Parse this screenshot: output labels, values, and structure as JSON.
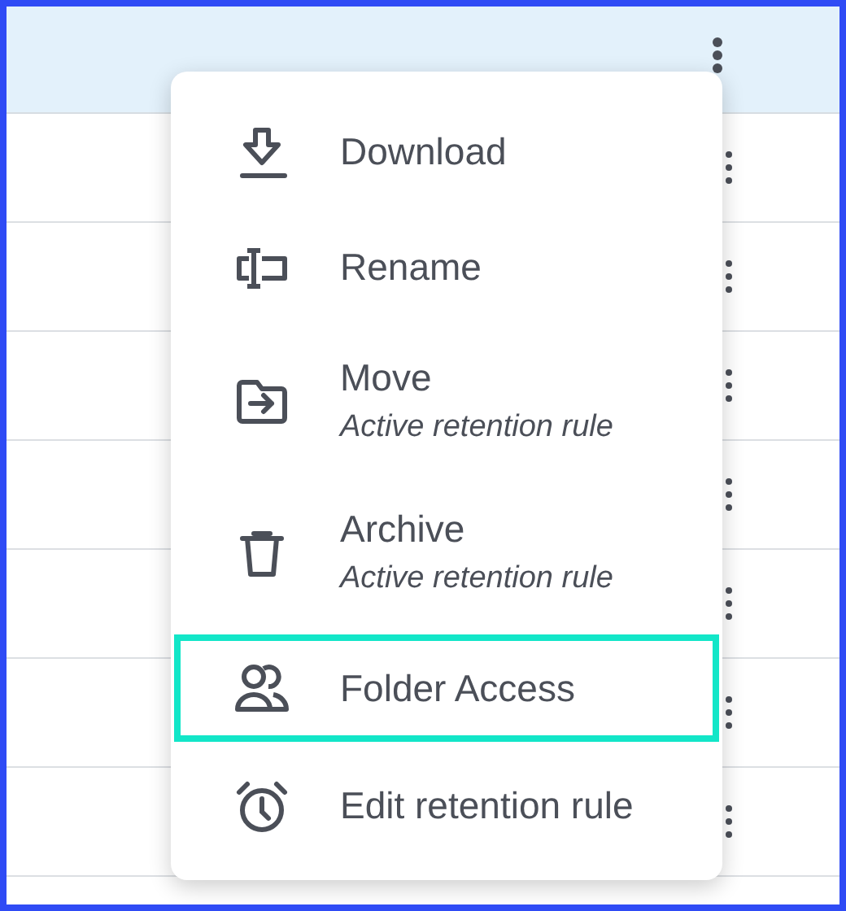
{
  "menu": {
    "items": [
      {
        "label": "Download",
        "selected": false
      },
      {
        "label": "Rename",
        "selected": false
      },
      {
        "label": "Move",
        "subtitle": "Active retention rule",
        "selected": false
      },
      {
        "label": "Archive",
        "subtitle": "Active retention rule",
        "selected": false
      },
      {
        "label": "Folder Access",
        "selected": true
      },
      {
        "label": "Edit retention rule",
        "selected": false
      }
    ]
  }
}
